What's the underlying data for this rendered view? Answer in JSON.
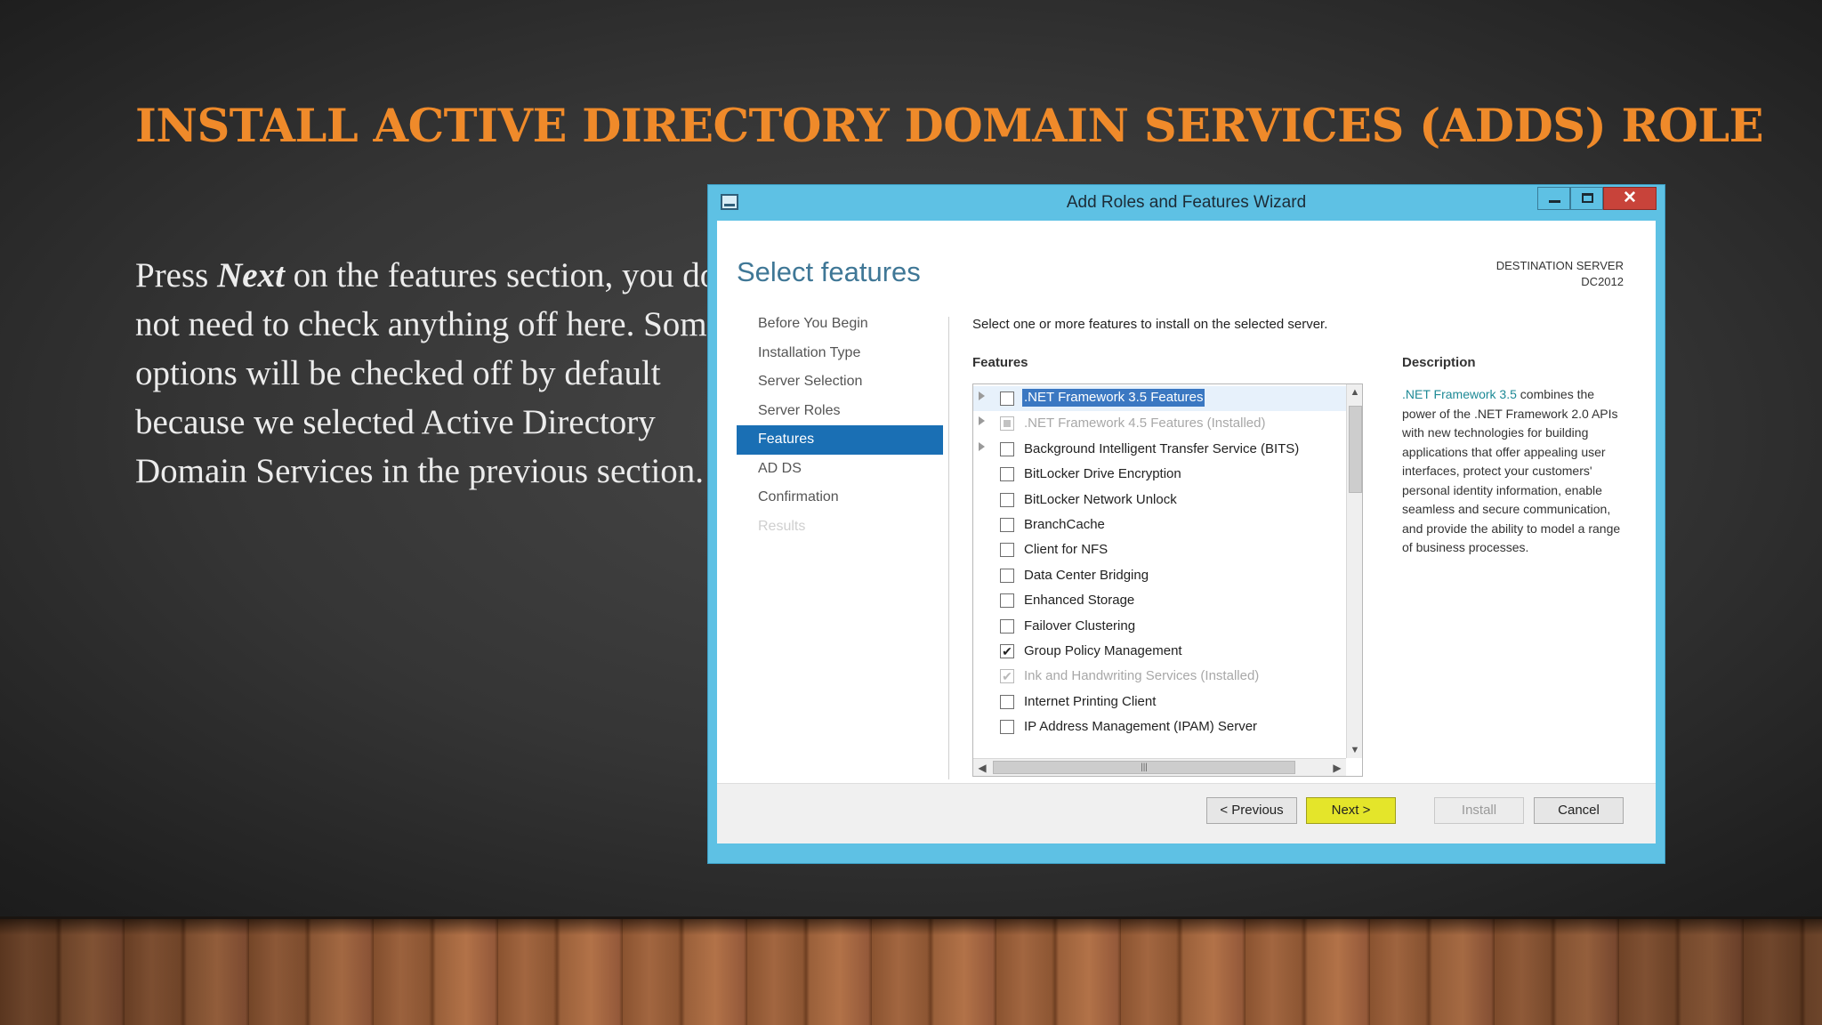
{
  "slide": {
    "title": "INSTALL ACTIVE DIRECTORY DOMAIN SERVICES (ADDS) ROLE",
    "body": {
      "part1": "Press ",
      "emphasis": "Next",
      "part2": " on the features section, you do not need to check anything off here.  Some options will be checked off by default because we selected Active Directory Domain Services in the previous section."
    }
  },
  "window": {
    "title": "Add Roles and Features Wizard",
    "controls": {
      "minimize": "minimize-icon",
      "maximize": "maximize-icon",
      "close": "close-icon",
      "close_glyph": "✕"
    }
  },
  "page": {
    "heading": "Select features",
    "destination_label": "DESTINATION SERVER",
    "destination_server": "DC2012",
    "instruction": "Select one or more features to install on the selected server."
  },
  "nav": {
    "items": [
      {
        "label": "Before You Begin",
        "state": "normal"
      },
      {
        "label": "Installation Type",
        "state": "normal"
      },
      {
        "label": "Server Selection",
        "state": "normal"
      },
      {
        "label": "Server Roles",
        "state": "normal"
      },
      {
        "label": "Features",
        "state": "active"
      },
      {
        "label": "AD DS",
        "state": "normal"
      },
      {
        "label": "Confirmation",
        "state": "normal"
      },
      {
        "label": "Results",
        "state": "disabled"
      }
    ]
  },
  "features": {
    "label": "Features",
    "items": [
      {
        "label": ".NET Framework 3.5 Features",
        "checked": false,
        "expandable": true,
        "selected": true,
        "disabled": false
      },
      {
        "label": ".NET Framework 4.5 Features (Installed)",
        "checked": "partial",
        "expandable": true,
        "selected": false,
        "disabled": true
      },
      {
        "label": "Background Intelligent Transfer Service (BITS)",
        "checked": false,
        "expandable": true,
        "selected": false,
        "disabled": false
      },
      {
        "label": "BitLocker Drive Encryption",
        "checked": false,
        "expandable": false,
        "selected": false,
        "disabled": false
      },
      {
        "label": "BitLocker Network Unlock",
        "checked": false,
        "expandable": false,
        "selected": false,
        "disabled": false
      },
      {
        "label": "BranchCache",
        "checked": false,
        "expandable": false,
        "selected": false,
        "disabled": false
      },
      {
        "label": "Client for NFS",
        "checked": false,
        "expandable": false,
        "selected": false,
        "disabled": false
      },
      {
        "label": "Data Center Bridging",
        "checked": false,
        "expandable": false,
        "selected": false,
        "disabled": false
      },
      {
        "label": "Enhanced Storage",
        "checked": false,
        "expandable": false,
        "selected": false,
        "disabled": false
      },
      {
        "label": "Failover Clustering",
        "checked": false,
        "expandable": false,
        "selected": false,
        "disabled": false
      },
      {
        "label": "Group Policy Management",
        "checked": true,
        "expandable": false,
        "selected": false,
        "disabled": false
      },
      {
        "label": "Ink and Handwriting Services (Installed)",
        "checked": true,
        "expandable": false,
        "selected": false,
        "disabled": true
      },
      {
        "label": "Internet Printing Client",
        "checked": false,
        "expandable": false,
        "selected": false,
        "disabled": false
      },
      {
        "label": "IP Address Management (IPAM) Server",
        "checked": false,
        "expandable": false,
        "selected": false,
        "disabled": false
      }
    ]
  },
  "description": {
    "label": "Description",
    "link_text": ".NET Framework 3.5",
    "text": " combines the power of the .NET Framework 2.0 APIs with new technologies for building applications that offer appealing user interfaces, protect your customers' personal identity information, enable seamless and secure communication, and provide the ability to model a range of business processes."
  },
  "buttons": {
    "previous": "< Previous",
    "next": "Next >",
    "install": "Install",
    "cancel": "Cancel"
  },
  "colors": {
    "title_accent": "#ef8a2a",
    "window_frame": "#5ec1e4",
    "nav_active": "#1a6fb4",
    "next_button": "#e4e52a",
    "close_button": "#c8433a"
  }
}
